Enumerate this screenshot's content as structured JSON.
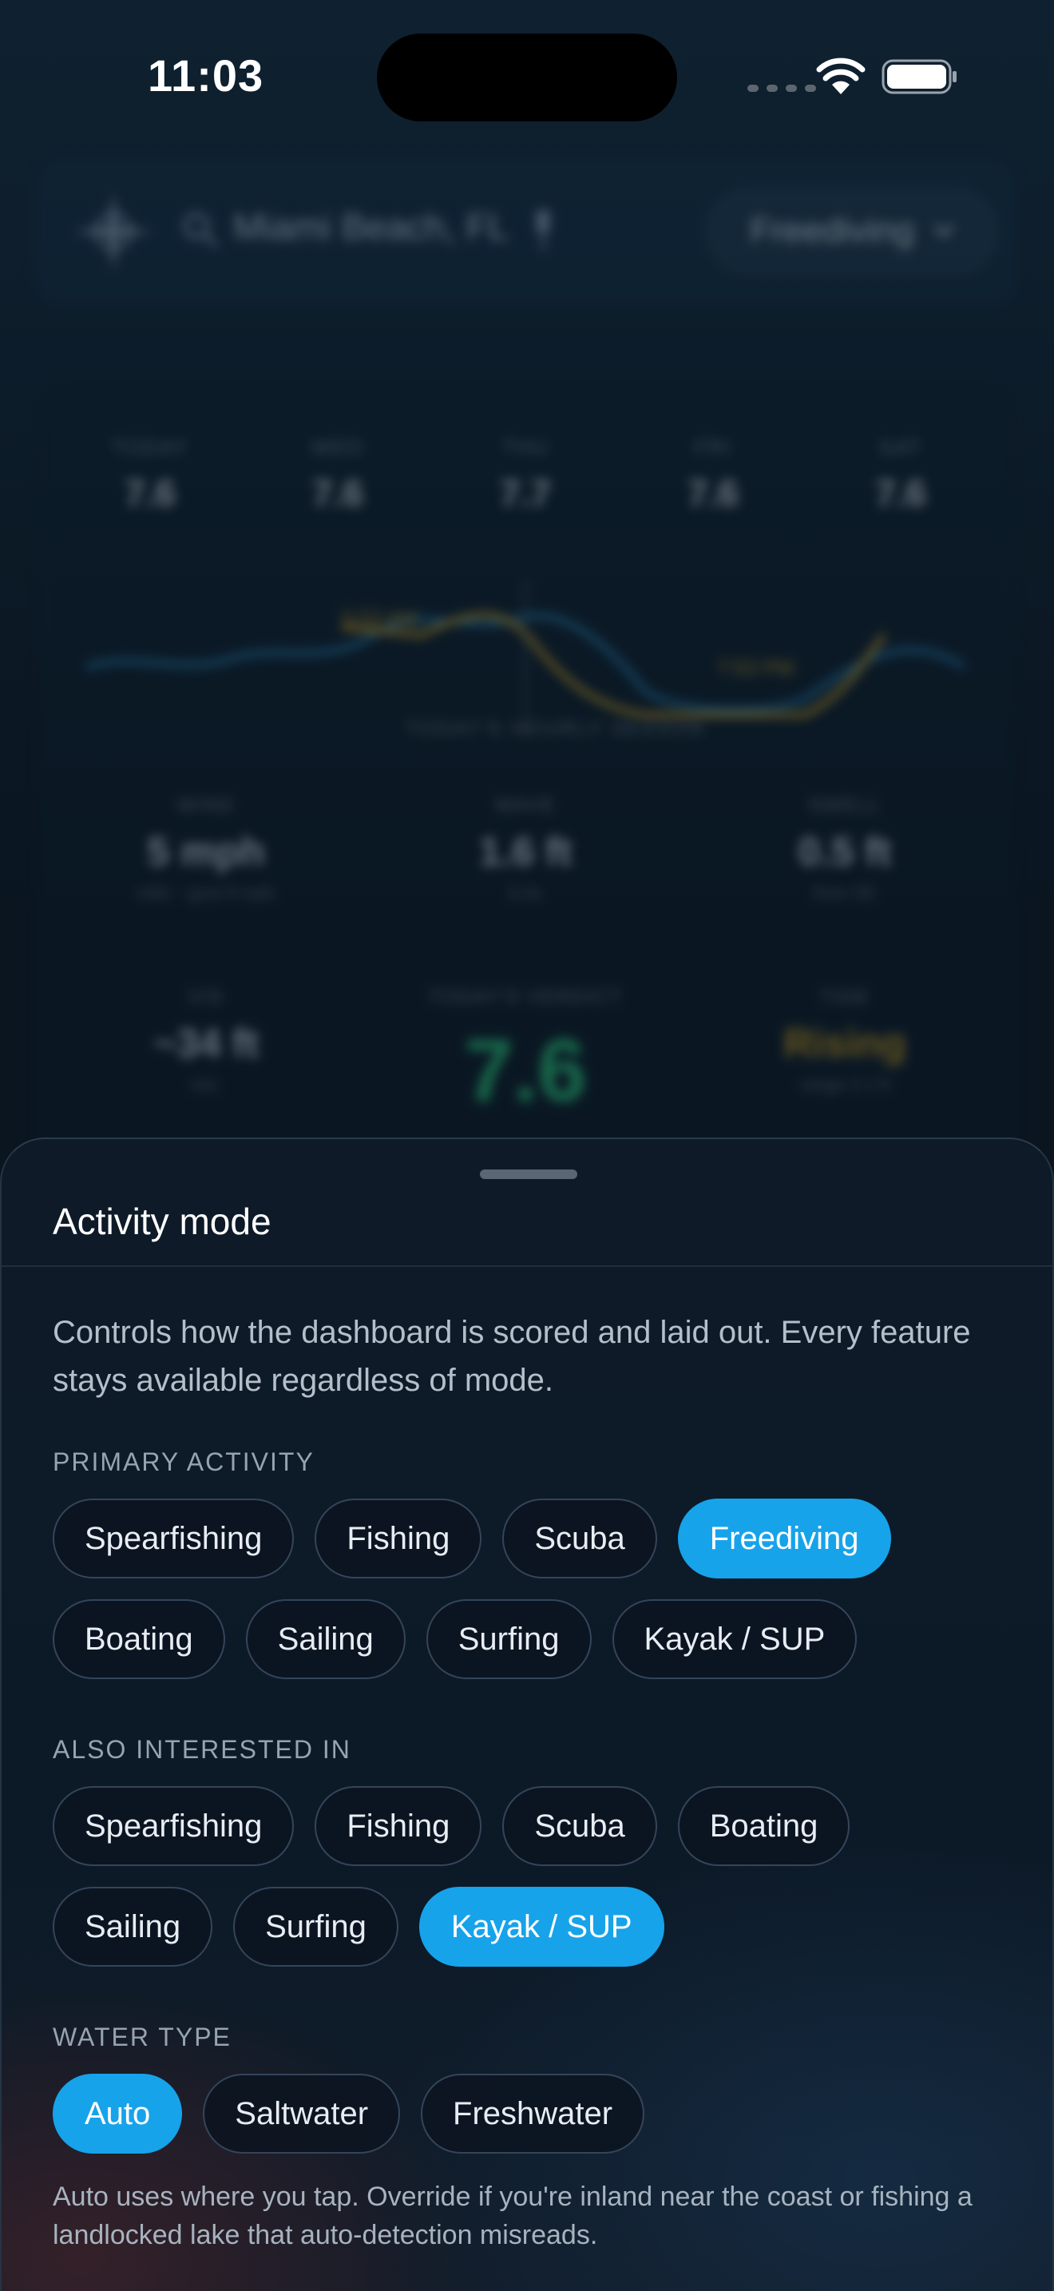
{
  "status_bar": {
    "time": "11:03"
  },
  "background": {
    "location": "Miami Beach, FL",
    "activity": "Freediving",
    "forecast": [
      {
        "day": "TODAY",
        "score": "7.6"
      },
      {
        "day": "WED",
        "score": "7.6"
      },
      {
        "day": "THU",
        "score": "7.7"
      },
      {
        "day": "FRI",
        "score": "7.6"
      },
      {
        "day": "SAT",
        "score": "7.6"
      }
    ],
    "chart_caption": "TODAY'S HOURLY SEASON",
    "tide_low_label": "5:53 AM",
    "tide_high_label": "7:53 PM",
    "metrics_top": [
      {
        "label": "WIND",
        "value": "5 mph",
        "sub": "mild ~ gust 8 mph"
      },
      {
        "label": "WAVE",
        "value": "1.6 ft",
        "sub": "6.0s"
      },
      {
        "label": "SWELL",
        "value": "0.5 ft",
        "sub": "from SE"
      }
    ],
    "metrics_bottom": [
      {
        "label": "VIS",
        "value": "~34 ft",
        "sub": "est."
      },
      {
        "label": "TODAY'S VERDICT",
        "value": "7.6",
        "sub": ""
      },
      {
        "label": "TIDE",
        "value": "Rising",
        "sub": "range 2.1 ft"
      }
    ]
  },
  "sheet": {
    "title": "Activity mode",
    "description": "Controls how the dashboard is scored and laid out. Every feature stays available regardless of mode.",
    "primary_label": "PRIMARY ACTIVITY",
    "primary_row1": [
      "Spearfishing",
      "Fishing",
      "Scuba",
      "Freediving"
    ],
    "primary_row2": [
      "Boating",
      "Sailing",
      "Surfing",
      "Kayak / SUP"
    ],
    "primary_selected": "Freediving",
    "also_label": "ALSO INTERESTED IN",
    "also_row1": [
      "Spearfishing",
      "Fishing",
      "Scuba",
      "Boating"
    ],
    "also_row2": [
      "Sailing",
      "Surfing",
      "Kayak / SUP"
    ],
    "also_selected": [
      "Kayak / SUP"
    ],
    "water_label": "WATER TYPE",
    "water_options": [
      "Auto",
      "Saltwater",
      "Freshwater"
    ],
    "water_selected": "Auto",
    "footnote": "Auto uses where you tap. Override if you're inland near the coast or fishing a landlocked lake that auto-detection misreads."
  },
  "colors": {
    "accent": "#17a3ea",
    "verdict": "#2bd080",
    "tide": "#d9a520",
    "wave": "#2a8fc8"
  }
}
